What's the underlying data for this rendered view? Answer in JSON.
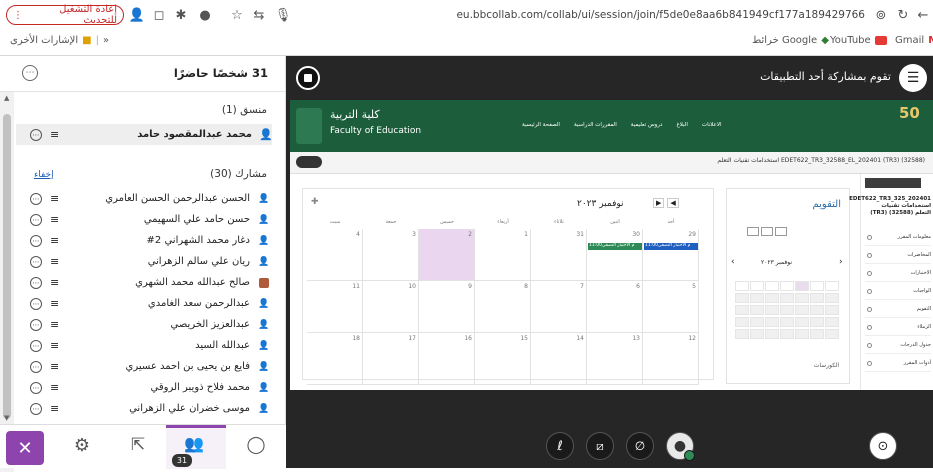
{
  "browser": {
    "reload_label": "إعادة التشغيل للتحديث",
    "url": "eu.bbcollab.com/collab/ui/session/join/f5de0e8aa6b841949cf177a189429766"
  },
  "bookmarks": {
    "other": "الإشارات الأخرى",
    "gmail": "Gmail",
    "youtube": "YouTube",
    "google_maps": "خرائط Google"
  },
  "panel": {
    "title": "31 شخصًا حاضرًا",
    "moderators_header": "منسق (1)",
    "participants_header": "مشارك (30)",
    "hide_link": "إخفاء",
    "moderators": [
      {
        "name": "محمد عبدالمقصود حامد"
      }
    ],
    "participants": [
      {
        "name": "الحسن عبدالرحمن الحسن العامري"
      },
      {
        "name": "حسن حامد علي السهيمي"
      },
      {
        "name": "دغار محمد الشهراني 2#"
      },
      {
        "name": "ريان علي سالم الزهراني"
      },
      {
        "name": "صالح عبدالله محمد الشهري"
      },
      {
        "name": "عبدالرحمن سعد الغامدي"
      },
      {
        "name": "عبدالعزيز الخريصي"
      },
      {
        "name": "عبدالله السيد"
      },
      {
        "name": "فايع بن يحيى بن أحمد عسيري"
      },
      {
        "name": "محمد فلاح ذويبر الروقي"
      },
      {
        "name": "موسى خضران علي الزهراني"
      }
    ],
    "attendees_badge": "31"
  },
  "stage": {
    "sharing_title": "تقوم بمشاركة أحد التطبيقات"
  },
  "shared": {
    "college_ar": "كلية التربية",
    "college_en": "Faculty of Education",
    "nav": [
      "الصفحة الرئيسية",
      "المقررات الدراسية",
      "دروس تعليمية",
      "البلاغ",
      "الاعلانات"
    ],
    "course_path": "(32588) (TR3) EDET622_TR3_32588_EL_202401 استخدامات تقنيات التعلم",
    "cal_month": "نوفمبر ٢٠٢٣",
    "cal_side_title": "التقويم",
    "mini_month": "نوفمبر ٢٠٢٣",
    "day_headers": [
      "أحد",
      "اثنين",
      "ثلاثاء",
      "أربعاء",
      "خميس",
      "جمعة",
      "سبت"
    ],
    "cal_dates": [
      "29",
      "30",
      "31",
      "1",
      "2",
      "3",
      "4",
      "5",
      "6",
      "7",
      "8",
      "9",
      "10",
      "11",
      "12",
      "13",
      "14",
      "15",
      "16",
      "17",
      "18"
    ],
    "events": [
      "11:00م الاختبار النصفي",
      "11:00م الاختبار النصفي"
    ],
    "course_title": "EDET622_TR3_325_202401 استخدامات تقنيات التعلم (32588) (TR3)",
    "menu": [
      "معلومات المقرر",
      "المحاضرات",
      "الاختبارات",
      "الواجبات",
      "التقويم",
      "الزملاء",
      "جدول الدرجات",
      "أدوات المقرر"
    ],
    "sidebar_footer": "الكورسات"
  },
  "colors": {
    "brand_green": "#1c5e3c",
    "accent_purple": "#8e44ad",
    "reload_red": "#c62828"
  }
}
